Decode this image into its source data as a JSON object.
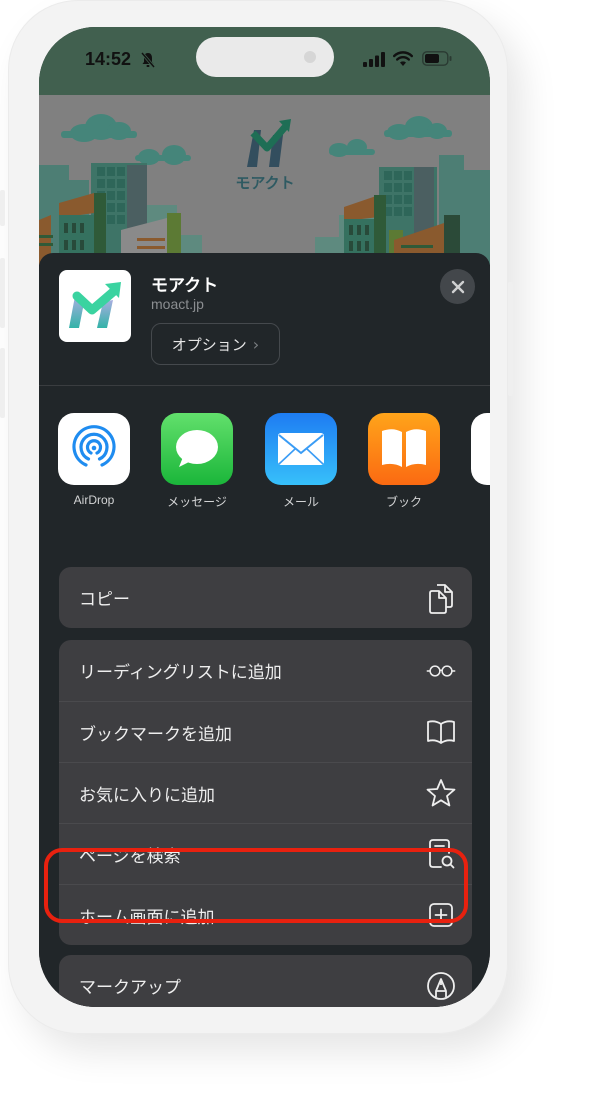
{
  "status_bar": {
    "time": "14:52",
    "icons": [
      "bell-slash-icon",
      "cellular-signal-icon",
      "wifi-icon",
      "battery-icon"
    ]
  },
  "banner": {
    "logo_text": "モアクト"
  },
  "share_sheet": {
    "app": {
      "title": "モアクト",
      "url": "moact.jp",
      "options_label": "オプション",
      "options_chevron": "›",
      "close_icon": "close-icon"
    },
    "apps": [
      {
        "label": "AirDrop",
        "icon": "airdrop-icon"
      },
      {
        "label": "メッセージ",
        "icon": "messages-icon"
      },
      {
        "label": "メール",
        "icon": "mail-icon"
      },
      {
        "label": "ブック",
        "icon": "books-icon"
      },
      {
        "label": "",
        "icon": "partial-app-icon"
      }
    ],
    "copy_group": [
      {
        "label": "コピー",
        "icon": "copy-icon"
      }
    ],
    "actions_group": [
      {
        "label": "リーディングリストに追加",
        "icon": "glasses-icon"
      },
      {
        "label": "ブックマークを追加",
        "icon": "book-icon"
      },
      {
        "label": "お気に入りに追加",
        "icon": "star-icon"
      },
      {
        "label": "ページを検索",
        "icon": "find-on-page-icon"
      },
      {
        "label": "ホーム画面に追加",
        "icon": "add-square-icon",
        "highlighted": true
      }
    ],
    "markup_group": [
      {
        "label": "マークアップ",
        "icon": "markup-pen-icon"
      }
    ]
  },
  "colors": {
    "status_bar_bg": "#41604f",
    "sheet_bg": "#212629",
    "row_bg": "#3e3e41",
    "highlight": "#e8210f",
    "brand_green": "#3ad3a0"
  }
}
